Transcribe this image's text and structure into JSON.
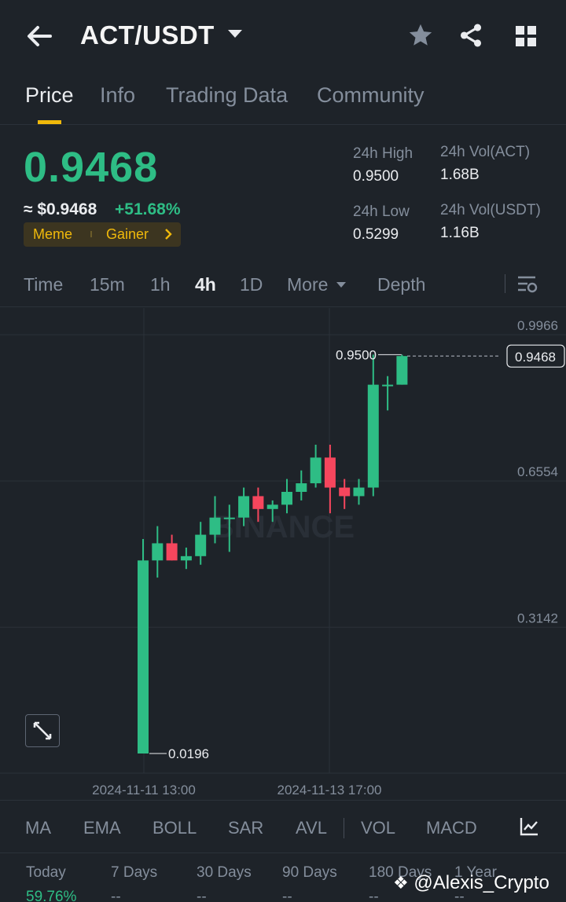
{
  "header": {
    "pair": "ACT/USDT"
  },
  "tabs": [
    {
      "label": "Price"
    },
    {
      "label": "Info"
    },
    {
      "label": "Trading Data"
    },
    {
      "label": "Community"
    }
  ],
  "ticker": {
    "price": "0.9468",
    "usd_price": "≈ $0.9468",
    "change": "+51.68%",
    "tags": [
      "Meme",
      "Gainer"
    ],
    "stats": {
      "high_label": "24h High",
      "high": "0.9500",
      "low_label": "24h Low",
      "low": "0.5299",
      "vol_act_label": "24h Vol(ACT)",
      "vol_act": "1.68B",
      "vol_usdt_label": "24h Vol(USDT)",
      "vol_usdt": "1.16B"
    }
  },
  "intervals": {
    "items": [
      "Time",
      "15m",
      "1h",
      "4h",
      "1D",
      "More",
      "Depth"
    ],
    "active": "4h"
  },
  "chart_data": {
    "type": "candlestick",
    "y_ticks": [
      "0.9966",
      "0.6554",
      "0.3142"
    ],
    "x_ticks": [
      "2024-11-11 13:00",
      "2024-11-13 17:00"
    ],
    "ylim": [
      0.0196,
      0.9966
    ],
    "last_price": "0.9468",
    "high_marker": "0.9500",
    "low_marker": "0.0196",
    "watermark": "BINANCE",
    "candles": [
      {
        "o": 0.0196,
        "h": 0.52,
        "l": 0.0196,
        "c": 0.47
      },
      {
        "o": 0.47,
        "h": 0.55,
        "l": 0.43,
        "c": 0.51
      },
      {
        "o": 0.51,
        "h": 0.53,
        "l": 0.47,
        "c": 0.47
      },
      {
        "o": 0.47,
        "h": 0.5,
        "l": 0.45,
        "c": 0.48
      },
      {
        "o": 0.48,
        "h": 0.56,
        "l": 0.46,
        "c": 0.53
      },
      {
        "o": 0.53,
        "h": 0.62,
        "l": 0.51,
        "c": 0.57
      },
      {
        "o": 0.57,
        "h": 0.6,
        "l": 0.49,
        "c": 0.57
      },
      {
        "o": 0.57,
        "h": 0.64,
        "l": 0.55,
        "c": 0.62
      },
      {
        "o": 0.62,
        "h": 0.64,
        "l": 0.56,
        "c": 0.59
      },
      {
        "o": 0.59,
        "h": 0.61,
        "l": 0.56,
        "c": 0.6
      },
      {
        "o": 0.6,
        "h": 0.66,
        "l": 0.58,
        "c": 0.63
      },
      {
        "o": 0.63,
        "h": 0.68,
        "l": 0.61,
        "c": 0.65
      },
      {
        "o": 0.65,
        "h": 0.74,
        "l": 0.64,
        "c": 0.71
      },
      {
        "o": 0.71,
        "h": 0.74,
        "l": 0.58,
        "c": 0.64
      },
      {
        "o": 0.64,
        "h": 0.66,
        "l": 0.59,
        "c": 0.62
      },
      {
        "o": 0.62,
        "h": 0.66,
        "l": 0.6,
        "c": 0.64
      },
      {
        "o": 0.64,
        "h": 0.95,
        "l": 0.62,
        "c": 0.88
      },
      {
        "o": 0.88,
        "h": 0.9,
        "l": 0.82,
        "c": 0.88
      },
      {
        "o": 0.88,
        "h": 0.95,
        "l": 0.88,
        "c": 0.9468
      }
    ],
    "up_color": "#2ebd85",
    "down_color": "#f6465d"
  },
  "indicators": [
    "MA",
    "EMA",
    "BOLL",
    "SAR",
    "AVL",
    "VOL",
    "MACD"
  ],
  "performance": {
    "labels": [
      "Today",
      "7 Days",
      "30 Days",
      "90 Days",
      "180 Days",
      "1 Year"
    ],
    "values": [
      "59.76%",
      "--",
      "--",
      "--",
      "--",
      "--"
    ]
  },
  "watermark_text": "@Alexis_Crypto",
  "colors": {
    "accent": "#f0b90b",
    "up": "#2ebd85",
    "down": "#f6465d",
    "bg": "#1e2329"
  }
}
